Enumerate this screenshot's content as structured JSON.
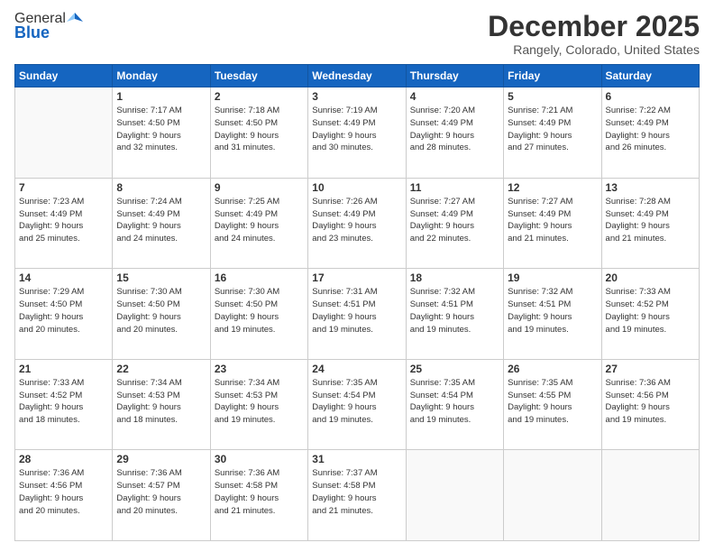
{
  "logo": {
    "general": "General",
    "blue": "Blue"
  },
  "title": "December 2025",
  "location": "Rangely, Colorado, United States",
  "weekdays": [
    "Sunday",
    "Monday",
    "Tuesday",
    "Wednesday",
    "Thursday",
    "Friday",
    "Saturday"
  ],
  "weeks": [
    [
      {
        "day": "",
        "sunrise": "",
        "sunset": "",
        "daylight": ""
      },
      {
        "day": "1",
        "sunrise": "Sunrise: 7:17 AM",
        "sunset": "Sunset: 4:50 PM",
        "daylight": "Daylight: 9 hours and 32 minutes."
      },
      {
        "day": "2",
        "sunrise": "Sunrise: 7:18 AM",
        "sunset": "Sunset: 4:50 PM",
        "daylight": "Daylight: 9 hours and 31 minutes."
      },
      {
        "day": "3",
        "sunrise": "Sunrise: 7:19 AM",
        "sunset": "Sunset: 4:49 PM",
        "daylight": "Daylight: 9 hours and 30 minutes."
      },
      {
        "day": "4",
        "sunrise": "Sunrise: 7:20 AM",
        "sunset": "Sunset: 4:49 PM",
        "daylight": "Daylight: 9 hours and 28 minutes."
      },
      {
        "day": "5",
        "sunrise": "Sunrise: 7:21 AM",
        "sunset": "Sunset: 4:49 PM",
        "daylight": "Daylight: 9 hours and 27 minutes."
      },
      {
        "day": "6",
        "sunrise": "Sunrise: 7:22 AM",
        "sunset": "Sunset: 4:49 PM",
        "daylight": "Daylight: 9 hours and 26 minutes."
      }
    ],
    [
      {
        "day": "7",
        "sunrise": "Sunrise: 7:23 AM",
        "sunset": "Sunset: 4:49 PM",
        "daylight": "Daylight: 9 hours and 25 minutes."
      },
      {
        "day": "8",
        "sunrise": "Sunrise: 7:24 AM",
        "sunset": "Sunset: 4:49 PM",
        "daylight": "Daylight: 9 hours and 24 minutes."
      },
      {
        "day": "9",
        "sunrise": "Sunrise: 7:25 AM",
        "sunset": "Sunset: 4:49 PM",
        "daylight": "Daylight: 9 hours and 24 minutes."
      },
      {
        "day": "10",
        "sunrise": "Sunrise: 7:26 AM",
        "sunset": "Sunset: 4:49 PM",
        "daylight": "Daylight: 9 hours and 23 minutes."
      },
      {
        "day": "11",
        "sunrise": "Sunrise: 7:27 AM",
        "sunset": "Sunset: 4:49 PM",
        "daylight": "Daylight: 9 hours and 22 minutes."
      },
      {
        "day": "12",
        "sunrise": "Sunrise: 7:27 AM",
        "sunset": "Sunset: 4:49 PM",
        "daylight": "Daylight: 9 hours and 21 minutes."
      },
      {
        "day": "13",
        "sunrise": "Sunrise: 7:28 AM",
        "sunset": "Sunset: 4:49 PM",
        "daylight": "Daylight: 9 hours and 21 minutes."
      }
    ],
    [
      {
        "day": "14",
        "sunrise": "Sunrise: 7:29 AM",
        "sunset": "Sunset: 4:50 PM",
        "daylight": "Daylight: 9 hours and 20 minutes."
      },
      {
        "day": "15",
        "sunrise": "Sunrise: 7:30 AM",
        "sunset": "Sunset: 4:50 PM",
        "daylight": "Daylight: 9 hours and 20 minutes."
      },
      {
        "day": "16",
        "sunrise": "Sunrise: 7:30 AM",
        "sunset": "Sunset: 4:50 PM",
        "daylight": "Daylight: 9 hours and 19 minutes."
      },
      {
        "day": "17",
        "sunrise": "Sunrise: 7:31 AM",
        "sunset": "Sunset: 4:51 PM",
        "daylight": "Daylight: 9 hours and 19 minutes."
      },
      {
        "day": "18",
        "sunrise": "Sunrise: 7:32 AM",
        "sunset": "Sunset: 4:51 PM",
        "daylight": "Daylight: 9 hours and 19 minutes."
      },
      {
        "day": "19",
        "sunrise": "Sunrise: 7:32 AM",
        "sunset": "Sunset: 4:51 PM",
        "daylight": "Daylight: 9 hours and 19 minutes."
      },
      {
        "day": "20",
        "sunrise": "Sunrise: 7:33 AM",
        "sunset": "Sunset: 4:52 PM",
        "daylight": "Daylight: 9 hours and 19 minutes."
      }
    ],
    [
      {
        "day": "21",
        "sunrise": "Sunrise: 7:33 AM",
        "sunset": "Sunset: 4:52 PM",
        "daylight": "Daylight: 9 hours and 18 minutes."
      },
      {
        "day": "22",
        "sunrise": "Sunrise: 7:34 AM",
        "sunset": "Sunset: 4:53 PM",
        "daylight": "Daylight: 9 hours and 18 minutes."
      },
      {
        "day": "23",
        "sunrise": "Sunrise: 7:34 AM",
        "sunset": "Sunset: 4:53 PM",
        "daylight": "Daylight: 9 hours and 19 minutes."
      },
      {
        "day": "24",
        "sunrise": "Sunrise: 7:35 AM",
        "sunset": "Sunset: 4:54 PM",
        "daylight": "Daylight: 9 hours and 19 minutes."
      },
      {
        "day": "25",
        "sunrise": "Sunrise: 7:35 AM",
        "sunset": "Sunset: 4:54 PM",
        "daylight": "Daylight: 9 hours and 19 minutes."
      },
      {
        "day": "26",
        "sunrise": "Sunrise: 7:35 AM",
        "sunset": "Sunset: 4:55 PM",
        "daylight": "Daylight: 9 hours and 19 minutes."
      },
      {
        "day": "27",
        "sunrise": "Sunrise: 7:36 AM",
        "sunset": "Sunset: 4:56 PM",
        "daylight": "Daylight: 9 hours and 19 minutes."
      }
    ],
    [
      {
        "day": "28",
        "sunrise": "Sunrise: 7:36 AM",
        "sunset": "Sunset: 4:56 PM",
        "daylight": "Daylight: 9 hours and 20 minutes."
      },
      {
        "day": "29",
        "sunrise": "Sunrise: 7:36 AM",
        "sunset": "Sunset: 4:57 PM",
        "daylight": "Daylight: 9 hours and 20 minutes."
      },
      {
        "day": "30",
        "sunrise": "Sunrise: 7:36 AM",
        "sunset": "Sunset: 4:58 PM",
        "daylight": "Daylight: 9 hours and 21 minutes."
      },
      {
        "day": "31",
        "sunrise": "Sunrise: 7:37 AM",
        "sunset": "Sunset: 4:58 PM",
        "daylight": "Daylight: 9 hours and 21 minutes."
      },
      {
        "day": "",
        "sunrise": "",
        "sunset": "",
        "daylight": ""
      },
      {
        "day": "",
        "sunrise": "",
        "sunset": "",
        "daylight": ""
      },
      {
        "day": "",
        "sunrise": "",
        "sunset": "",
        "daylight": ""
      }
    ]
  ]
}
